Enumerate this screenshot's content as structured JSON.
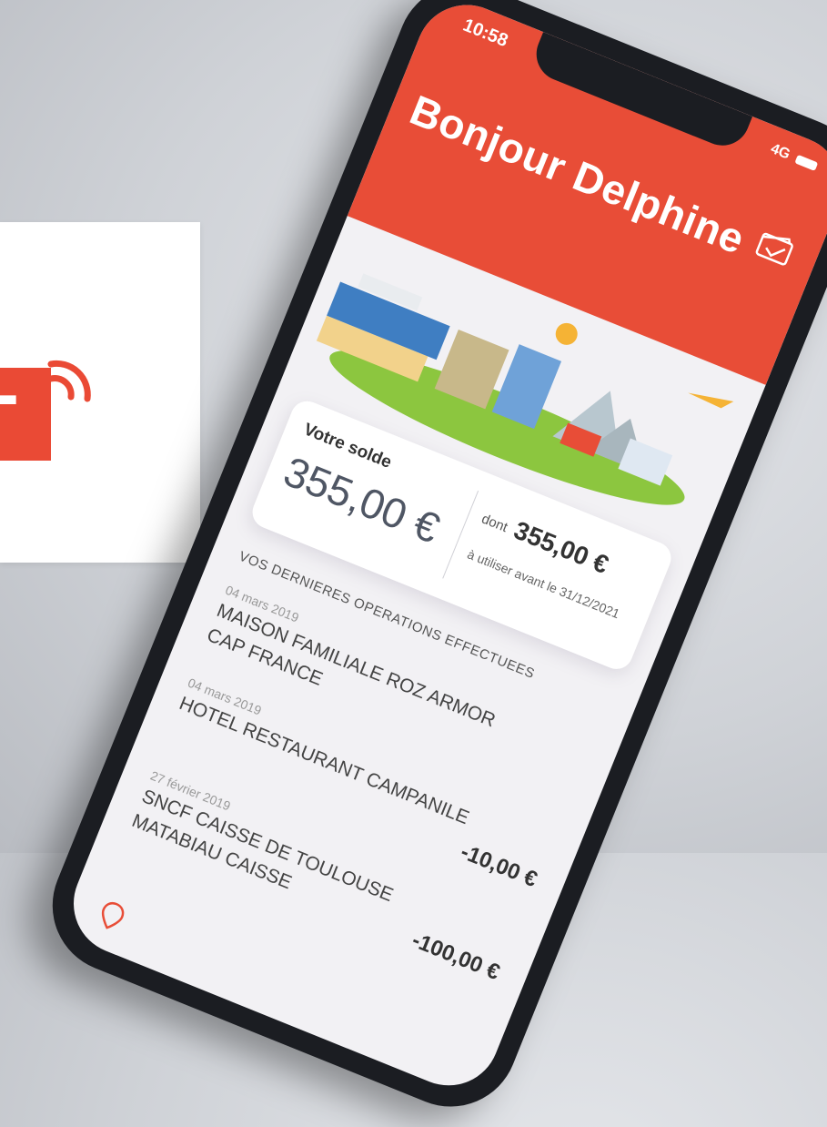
{
  "logo": {
    "letter": "T",
    "brand_color": "#ea4a35"
  },
  "status_bar": {
    "time": "10:58",
    "network": "4G"
  },
  "header": {
    "greeting": "Bonjour Delphine",
    "wallet_icon": "wallet-icon",
    "color": "#e84d37"
  },
  "balance": {
    "label": "Votre solde",
    "amount": "355,00 €",
    "dont_prefix": "dont",
    "dont_amount": "355,00 €",
    "expiry": "à utiliser avant le 31/12/2021"
  },
  "operations": {
    "title": "VOS DERNIERES OPERATIONS EFFECTUEES",
    "items": [
      {
        "date": "04 mars 2019",
        "label_line1": "MAISON FAMILIALE ROZ ARMOR",
        "label_line2": "CAP FRANCE",
        "amount": ""
      },
      {
        "date": "04 mars 2019",
        "label_line1": "HOTEL RESTAURANT CAMPANILE",
        "label_line2": "",
        "amount": "-10,00 €"
      },
      {
        "date": "27 février 2019",
        "label_line1": "SNCF CAISSE DE TOULOUSE",
        "label_line2": "MATABIAU CAISSE",
        "amount": "-100,00 €"
      }
    ]
  }
}
